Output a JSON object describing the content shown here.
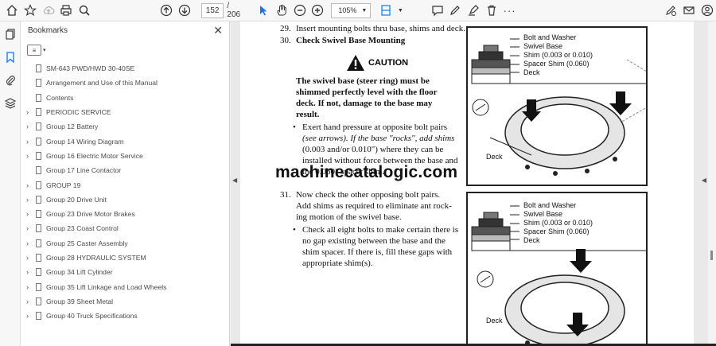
{
  "toolbar": {
    "page_current": "152",
    "page_total": "/ 206",
    "zoom": "105%",
    "icons": [
      "home-icon",
      "star-icon",
      "upload-icon",
      "print-icon",
      "search-icon",
      "page-up-icon",
      "page-down-icon",
      "cursor-icon",
      "hand-icon",
      "zoom-out-icon",
      "zoom-in-icon",
      "fit-icon",
      "comment-icon",
      "pen-icon",
      "highlight-icon",
      "delete-icon",
      "sign-icon",
      "mail-icon",
      "account-icon"
    ]
  },
  "panel": {
    "title": "Bookmarks",
    "close": "✕",
    "items": [
      {
        "label": "SM-643 PWD/HWD 30-40SE",
        "expandable": false
      },
      {
        "label": "Arrangement and Use of this Manual",
        "expandable": false
      },
      {
        "label": "Contents",
        "expandable": false
      },
      {
        "label": "PERIODIC SERVICE",
        "expandable": true
      },
      {
        "label": "Group 12 Battery",
        "expandable": true
      },
      {
        "label": "Group 14 Wiring Diagram",
        "expandable": true
      },
      {
        "label": "Group 16 Electric Motor Service",
        "expandable": true
      },
      {
        "label": "Group 17 Line Contactor",
        "expandable": false
      },
      {
        "label": "GROUP 19",
        "expandable": true
      },
      {
        "label": "Group 20 Drive Unit",
        "expandable": true
      },
      {
        "label": "Group 23 Drive Motor Brakes",
        "expandable": true
      },
      {
        "label": "Group 23 Coast Control",
        "expandable": true
      },
      {
        "label": "Group 25 Caster Assembly",
        "expandable": true
      },
      {
        "label": "Group 28 HYDRAULIC SYSTEM",
        "expandable": true
      },
      {
        "label": "Group 34 Lift Cylinder",
        "expandable": true
      },
      {
        "label": "Group 35 Lift Linkage and Load Wheels",
        "expandable": true
      },
      {
        "label": "Group 39 Sheet Metal",
        "expandable": true
      },
      {
        "label": "Group 40 Truck Specifications",
        "expandable": true
      }
    ]
  },
  "document": {
    "step29_num": "29.",
    "step29_text": "Insert mounting bolts thru base, shims and deck.",
    "step30_num": "30.",
    "step30_text": "Check Swivel Base Mounting",
    "caution_label": "CAUTION",
    "caution_body": [
      "The swivel base (steer ring) must be",
      "shimmed perfectly level with the floor",
      "deck. If not, damage to the base may",
      "result."
    ],
    "bullet1": [
      "Exert hand pressure at opposite bolt pairs",
      "(see arrows). If the base \"rocks\", add shims",
      "(0.003 and/or 0.010\") where they can be",
      "installed without force between the base and",
      "the 0.060\" spacer shim."
    ],
    "step31_num": "31.",
    "step31_text": [
      "Now check the other opposing bolt pairs.",
      "Add shims as required to eliminate ant rock-",
      "ing motion of the swivel base."
    ],
    "bullet2": [
      "Check all eight bolts to make certain there is",
      "no gap existing between the base and the",
      "shim spacer. If there is, fill these gaps with",
      "appropriate shim(s)."
    ],
    "watermark": "machinecatalogic.com",
    "figure1_labels": [
      "Bolt and Washer",
      "Swivel Base",
      "Shim (0.003 or 0.010)",
      "Spacer Shim (0.060)",
      "Deck"
    ],
    "figure1_deck": "Deck",
    "figure2_labels": [
      "Bolt and Washer",
      "Swivel Base",
      "Shim (0.003 or 0.010)",
      "Spacer Shim (0.060)",
      "Deck"
    ],
    "figure2_deck": "Deck"
  }
}
